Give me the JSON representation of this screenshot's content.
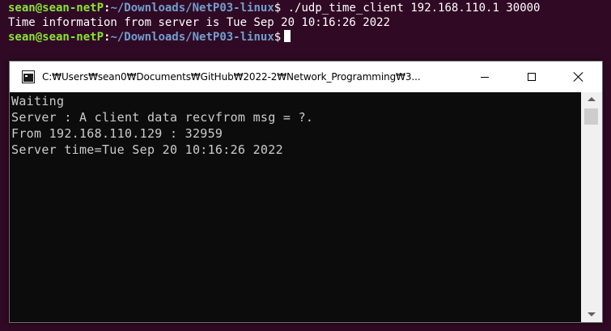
{
  "ubuntu_terminal": {
    "lines": [
      {
        "user_host": "sean@sean-netP",
        "colon": ":",
        "path": "~/Downloads/NetP03-linux",
        "dollar": "$",
        "command": " ./udp_time_client 192.168.110.1 30000"
      },
      {
        "text": "Time information from server is Tue Sep 20 10:16:26 2022"
      },
      {
        "user_host": "sean@sean-netP",
        "colon": ":",
        "path": "~/Downloads/NetP03-linux",
        "dollar": "$",
        "command": ""
      }
    ]
  },
  "console_window": {
    "title": "C:₩Users₩sean0₩Documents₩GitHub₩2022-2₩Network_Programming₩3...",
    "icon": "console-app-icon",
    "controls": {
      "minimize": "minimize-icon",
      "maximize": "maximize-icon",
      "close": "close-icon"
    },
    "output_lines": [
      "Waiting",
      "Server : A client data recvfrom msg = ?.",
      "From 192.168.110.129 : 32959",
      "Server time=Tue Sep 20 10:16:26 2022"
    ]
  },
  "colors": {
    "ubuntu_background": "#300a24",
    "prompt_user": "#8ae234",
    "prompt_path": "#729fcf",
    "console_background": "#0c0c0c",
    "console_text": "#cccccc"
  }
}
